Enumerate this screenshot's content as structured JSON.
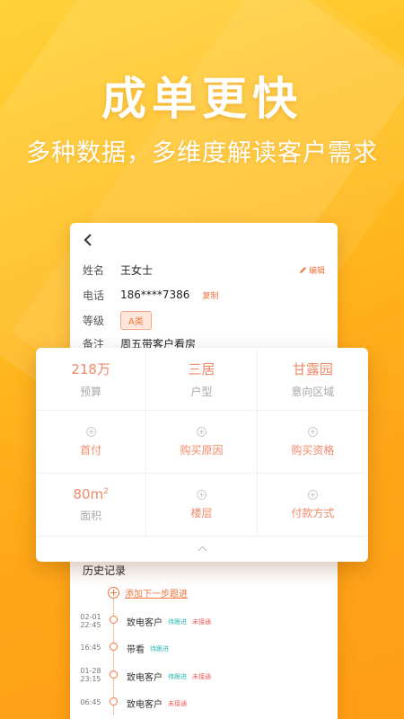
{
  "headline": "成单更快",
  "subheadline": "多种数据，多维度解读客户需求",
  "customer": {
    "name_label": "姓名",
    "name_value": "王女士",
    "edit_label": "编辑",
    "phone_label": "电话",
    "phone_value": "186****7386",
    "copy_label": "复制",
    "level_label": "等级",
    "level_value": "A类",
    "note_label": "备注",
    "note_value": "周五带客户看房"
  },
  "stats": [
    {
      "value": "218万",
      "label": "预算"
    },
    {
      "value": "三居",
      "label": "户型"
    },
    {
      "value": "甘露园",
      "label": "意向区域"
    }
  ],
  "actions_row": [
    "首付",
    "购买原因",
    "购买资格"
  ],
  "area": {
    "value": "80m",
    "exp": "2",
    "label": "面积"
  },
  "actions_row3": [
    "楼层",
    "付款方式"
  ],
  "history": {
    "title": "历史记录",
    "add_label": "添加下一步跟进",
    "items": [
      {
        "date": "02-01",
        "time": "22:45",
        "type": "致电客户",
        "tags": [
          "待跟进",
          "未接通"
        ]
      },
      {
        "date": "",
        "time": "16:45",
        "type": "带看",
        "tags": [
          "待跟进"
        ]
      },
      {
        "date": "01-28",
        "time": "23:15",
        "type": "致电客户",
        "tags": [
          "待跟进",
          "未接通"
        ]
      },
      {
        "date": "",
        "time": "06:45",
        "type": "致电客户",
        "tags": [
          "未接通"
        ]
      }
    ]
  },
  "colors": {
    "accent": "#f0763f",
    "teal": "#2bb7b3",
    "red": "#f05a5a"
  }
}
